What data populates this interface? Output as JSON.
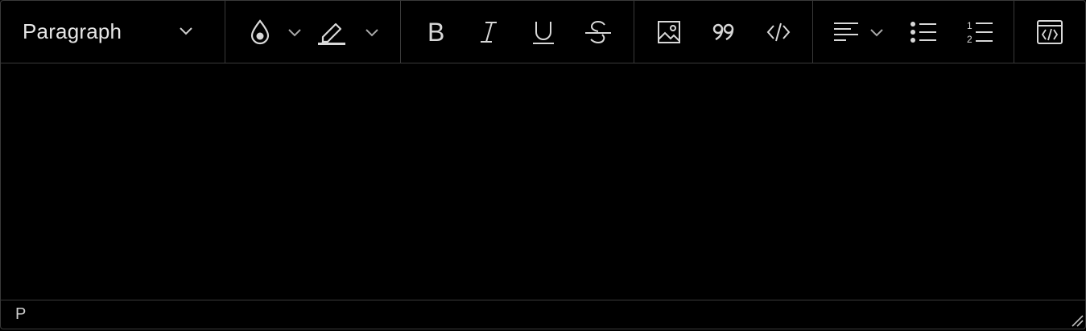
{
  "toolbar": {
    "block_format": {
      "value": "Paragraph",
      "icon": "chevron-down-icon"
    },
    "text_color": {
      "icon": "text-color-drop-icon",
      "dropdown_icon": "chevron-down-icon"
    },
    "highlight": {
      "icon": "highlighter-icon",
      "dropdown_icon": "chevron-down-icon"
    },
    "bold": {
      "label": "B"
    },
    "italic": {
      "label": "I"
    },
    "underline": {
      "label": "U"
    },
    "strikethrough": {
      "label": "S"
    },
    "image": {
      "icon": "image-icon"
    },
    "blockquote": {
      "icon": "quote-icon"
    },
    "code": {
      "icon": "code-icon"
    },
    "align": {
      "icon": "align-left-icon",
      "dropdown_icon": "chevron-down-icon"
    },
    "bullet_list": {
      "icon": "bullet-list-icon"
    },
    "numbered_list": {
      "icon": "numbered-list-icon",
      "numbers": [
        "1",
        "2"
      ]
    },
    "source_code": {
      "icon": "source-code-icon"
    }
  },
  "editor": {
    "content": ""
  },
  "statusbar": {
    "element_path": "P"
  },
  "colors": {
    "background": "#000000",
    "border": "#3a3a3a",
    "icon": "#d8d8d8",
    "text": "#e6e6e6"
  }
}
